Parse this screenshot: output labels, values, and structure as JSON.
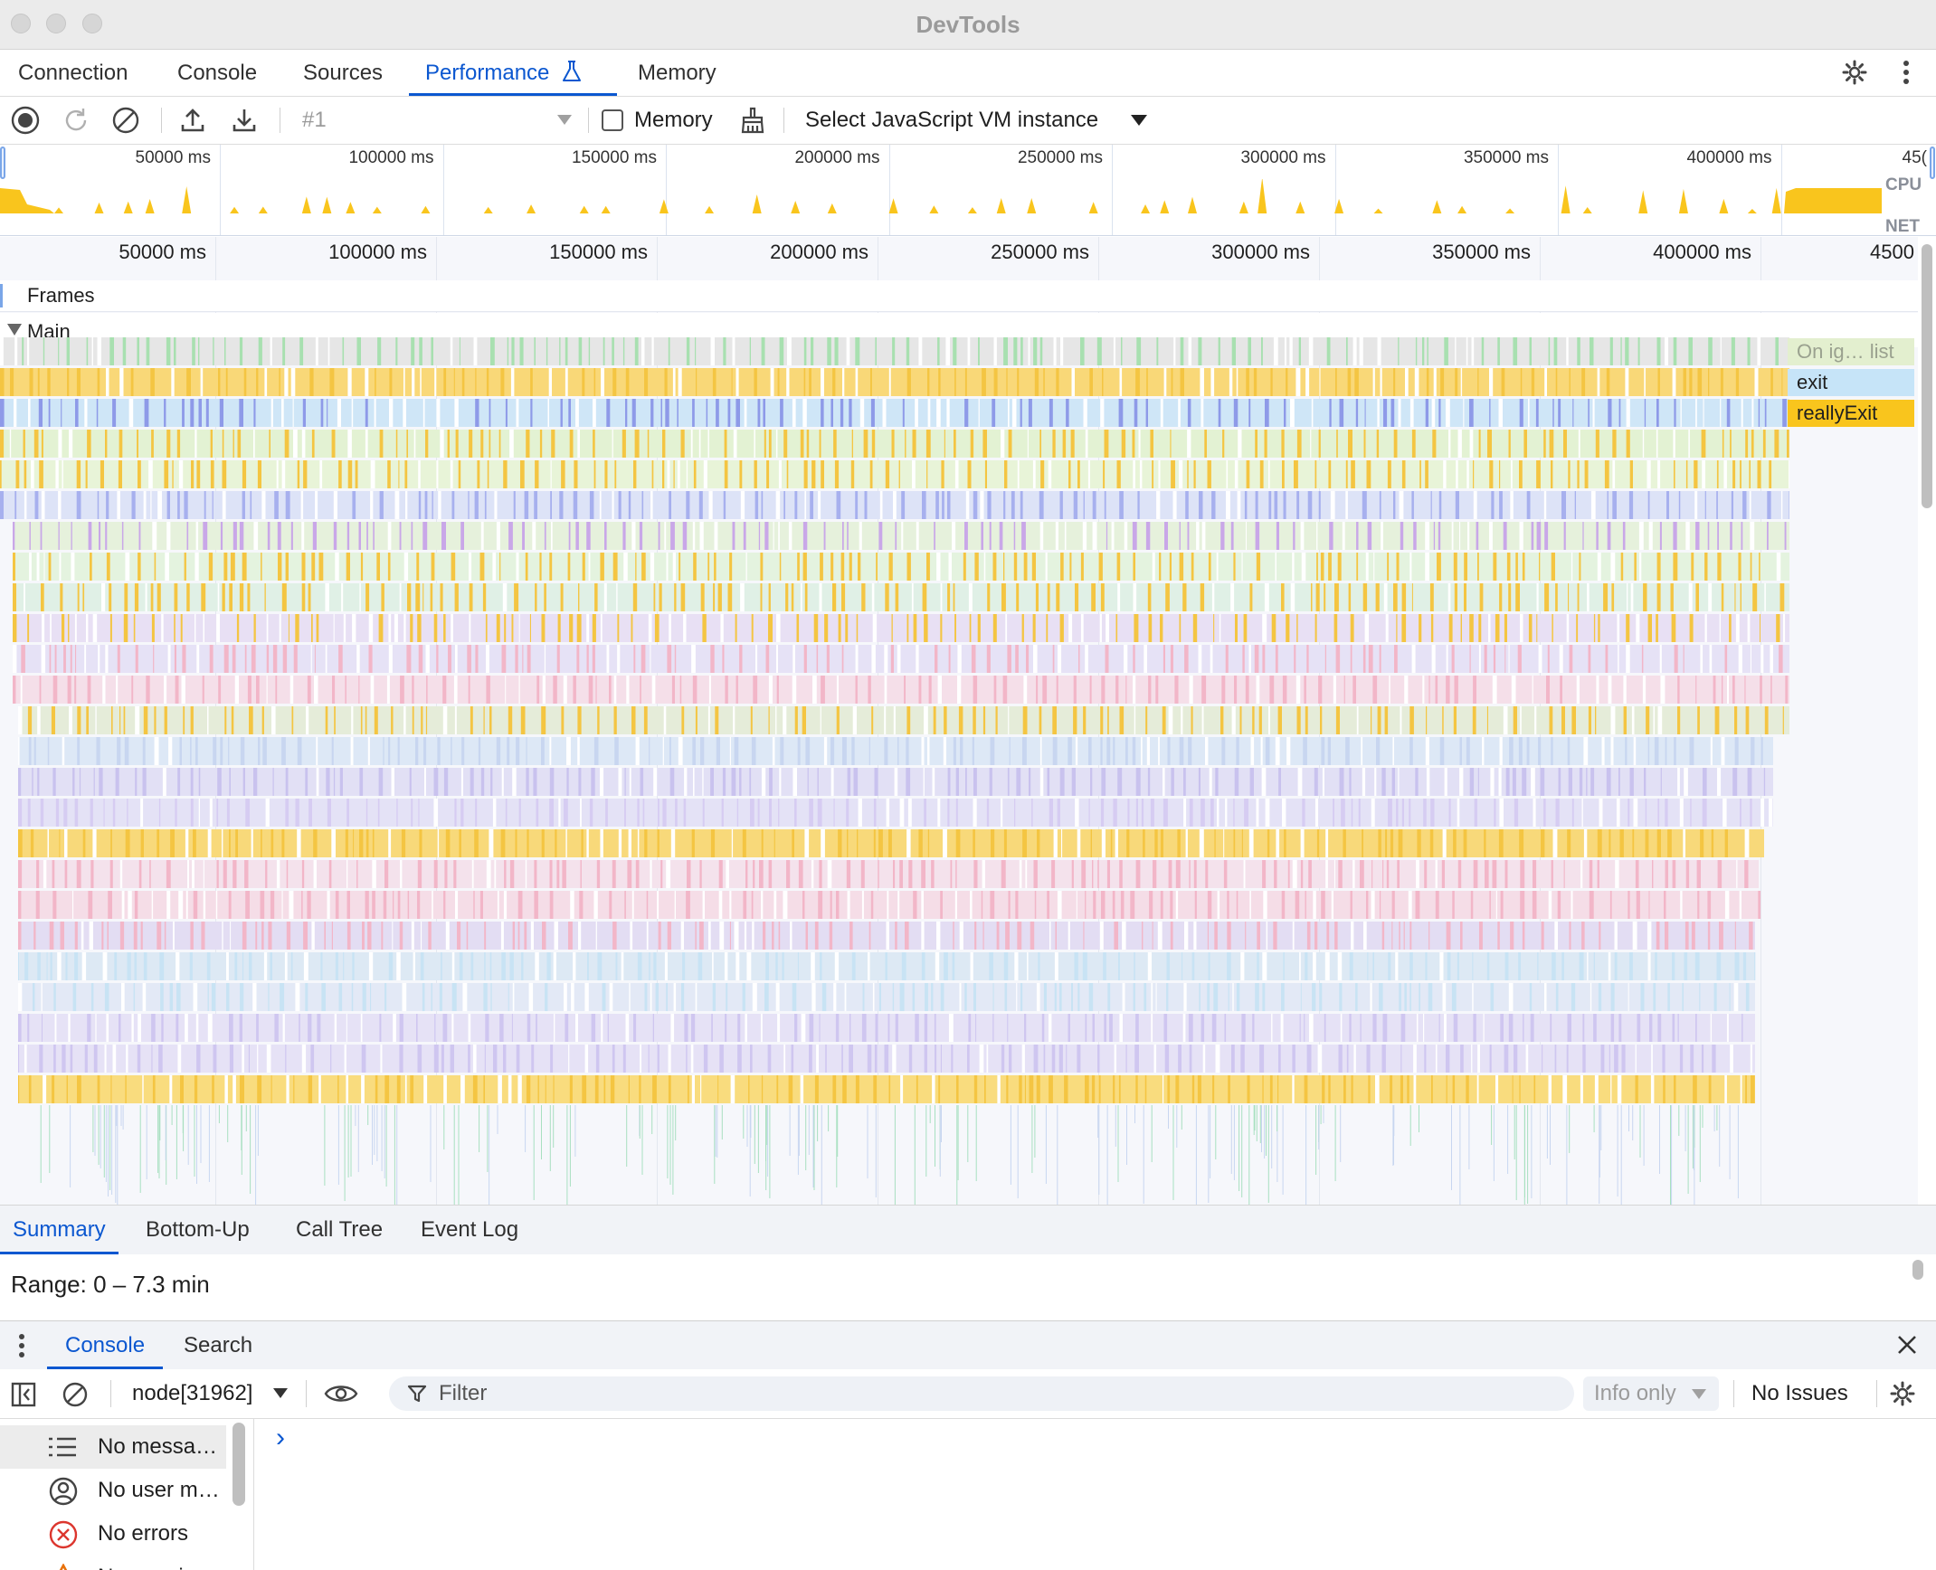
{
  "window": {
    "title": "DevTools"
  },
  "tabs": [
    {
      "label": "Connection"
    },
    {
      "label": "Console"
    },
    {
      "label": "Sources"
    },
    {
      "label": "Performance",
      "active": true
    },
    {
      "label": "Memory"
    }
  ],
  "toolbar": {
    "recording_select": "#1",
    "memory_checkbox_label": "Memory",
    "memory_checked": false,
    "vm_select": "Select JavaScript VM instance"
  },
  "overview": {
    "ticks": [
      "50000 ms",
      "100000 ms",
      "150000 ms",
      "200000 ms",
      "250000 ms",
      "300000 ms",
      "350000 ms",
      "400000 ms",
      "45("
    ],
    "cpu_label": "CPU",
    "net_label": "NET"
  },
  "timeline": {
    "ticks": [
      "50000 ms",
      "100000 ms",
      "150000 ms",
      "200000 ms",
      "250000 ms",
      "300000 ms",
      "350000 ms",
      "400000 ms",
      "4500"
    ],
    "frames_label": "Frames",
    "main_label": "Main",
    "right_entries": [
      {
        "label": "On ig… list",
        "color": "#e3efcf"
      },
      {
        "label": "exit",
        "color": "#c6e4f8"
      },
      {
        "label": "reallyExit",
        "color": "#f9c51d"
      }
    ]
  },
  "detail_tabs": [
    {
      "label": "Summary",
      "active": true
    },
    {
      "label": "Bottom-Up"
    },
    {
      "label": "Call Tree"
    },
    {
      "label": "Event Log"
    }
  ],
  "summary": {
    "range": "Range: 0 – 7.3 min"
  },
  "drawer": {
    "tabs": [
      {
        "label": "Console",
        "active": true
      },
      {
        "label": "Search"
      }
    ],
    "context": "node[31962]",
    "filter_placeholder": "Filter",
    "levels": "Info only",
    "issues": "No Issues",
    "sidebar": [
      {
        "label": "No messa…",
        "icon": "list-icon"
      },
      {
        "label": "No user m…",
        "icon": "user-icon"
      },
      {
        "label": "No errors",
        "icon": "error-icon"
      },
      {
        "label": "No warni…",
        "icon": "warning-icon"
      }
    ],
    "prompt": "›"
  },
  "colors": {
    "accent": "#0b57d0",
    "cpu_yellow": "#f9c51d",
    "error_red": "#dc362e",
    "warning_orange": "#e8710a"
  }
}
